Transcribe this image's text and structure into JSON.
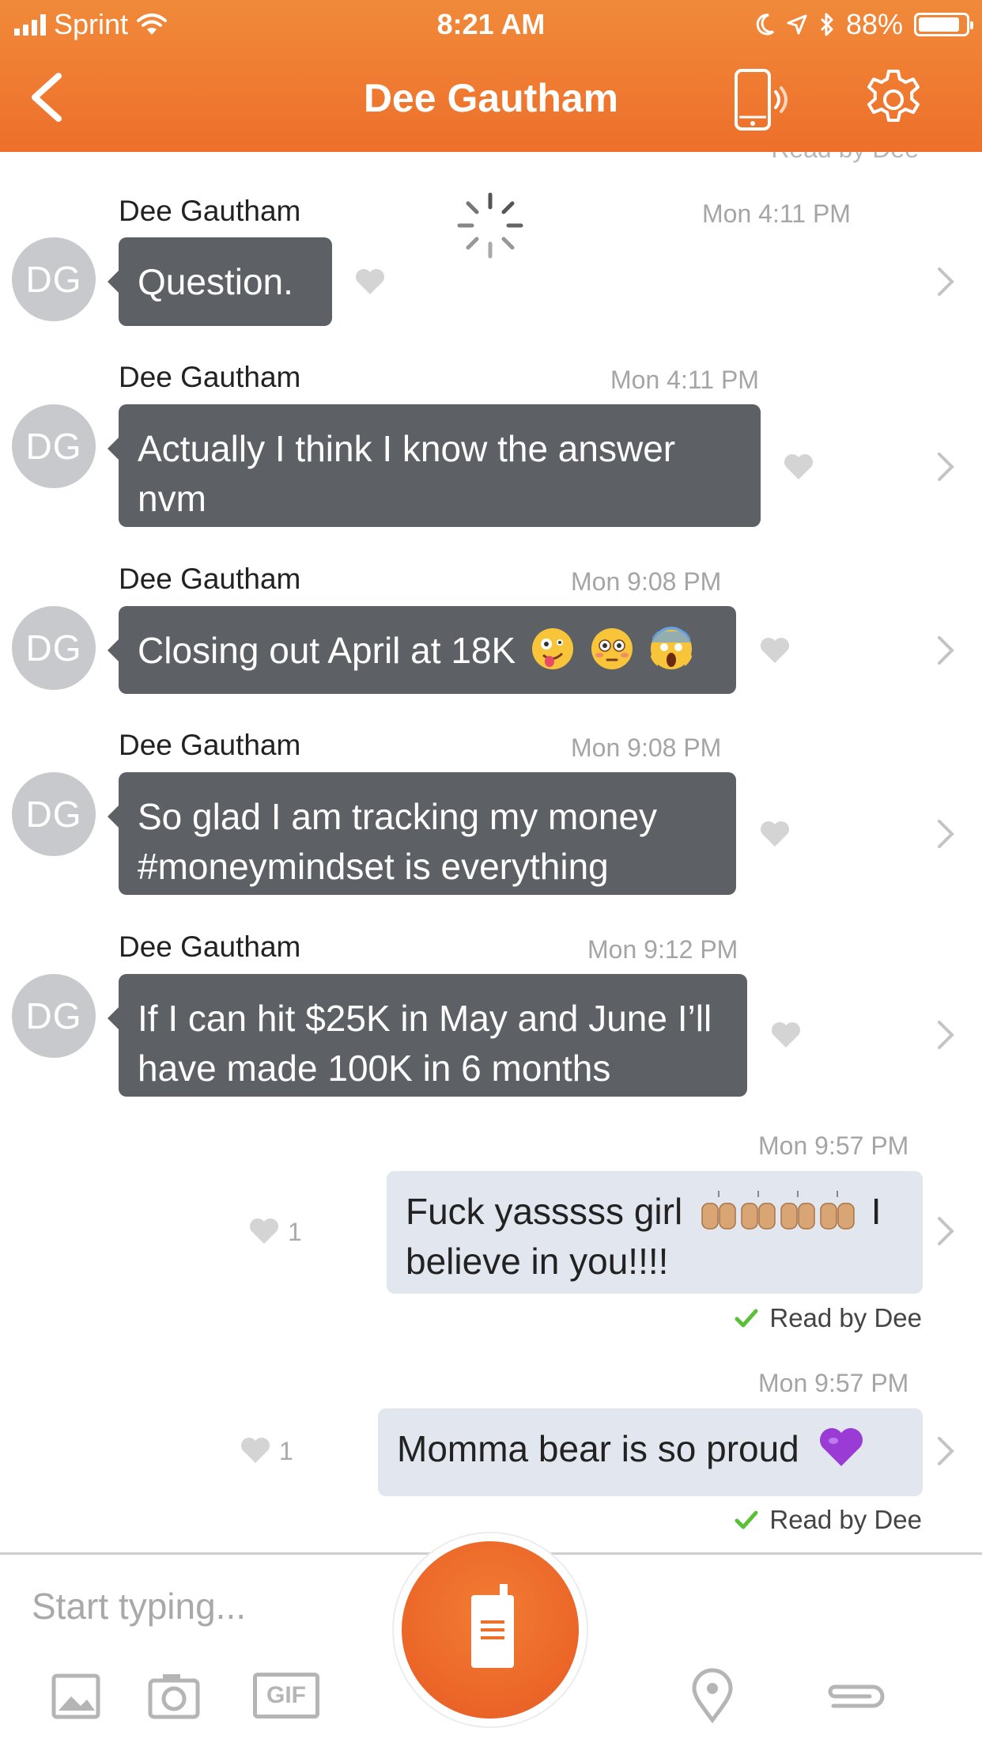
{
  "status_bar": {
    "carrier": "Sprint",
    "time": "8:21 AM",
    "battery": "88%",
    "battery_level": 0.88
  },
  "header": {
    "title": "Dee Gautham",
    "back_icon": "chevron-left-icon",
    "call_icon": "phone-icon",
    "settings_icon": "gear-icon"
  },
  "top_read_receipt": "Read by Dee",
  "messages": [
    {
      "sender": "Dee Gautham",
      "initials": "DG",
      "time": "Mon 4:11 PM",
      "text": "Question."
    },
    {
      "sender": "Dee Gautham",
      "initials": "DG",
      "time": "Mon 4:11 PM",
      "text": "Actually I think I know the answer nvm"
    },
    {
      "sender": "Dee Gautham",
      "initials": "DG",
      "time": "Mon 9:08 PM",
      "text": "Closing out April at 18K"
    },
    {
      "sender": "Dee Gautham",
      "initials": "DG",
      "time": "Mon 9:08 PM",
      "text": "So glad I am tracking my money #moneymindset is everything"
    },
    {
      "sender": "Dee Gautham",
      "initials": "DG",
      "time": "Mon 9:12 PM",
      "text": "If I can hit $25K in May and June I’ll have made 100K in 6 months"
    },
    {
      "time": "Mon 9:57 PM",
      "text_a": "Fuck yasssss girl",
      "text_b": "I believe in you!!!!",
      "likes": "1",
      "read": "Read by Dee"
    },
    {
      "time": "Mon 9:57 PM",
      "text": "Momma bear is so proud",
      "likes": "1",
      "read": "Read by Dee"
    }
  ],
  "composer": {
    "placeholder": "Start typing...",
    "tools": [
      "image-icon",
      "camera-icon",
      "gif-icon",
      "walkie-talkie-icon",
      "location-pin-icon",
      "paperclip-icon"
    ],
    "gif_label": "GIF"
  },
  "colors": {
    "header_orange": "#ee6f2a",
    "incoming_bubble": "#5d6166",
    "outgoing_bubble": "#e2e6ee",
    "read_check": "#5cbf3a"
  }
}
